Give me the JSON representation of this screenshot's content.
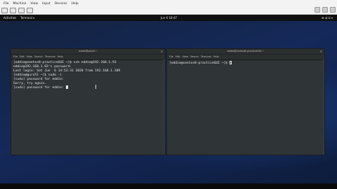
{
  "vbox": {
    "menu": [
      "File",
      "Machine",
      "View",
      "Input",
      "Devices",
      "Help"
    ]
  },
  "topbar": {
    "activities": "Activities",
    "app": "Terminal ▾",
    "clock": "Jun 6 18:47",
    "system": "⊞ ◂) ⏻ ▾"
  },
  "term_left": {
    "title": "eddie@solo0:~",
    "close": "✕",
    "menu": [
      "File",
      "Edit",
      "View",
      "Search",
      "Terminal",
      "Help"
    ],
    "lines": [
      "[eddie@centos8-practiceGUI ~]$ ssh eddie@192.168.1.93",
      "eddie@192.168.1.93's password:",
      "Last login: Sat Jun  6 14:53:31 2020 from 192.168.1.109",
      "[eddie@guru51 ~]$ sudo -i",
      "[sudo] password for eddie:",
      "Sorry, try again.",
      "[sudo] password for eddie: "
    ]
  },
  "term_right": {
    "title": "eddie@centos8-practiceGUI:~",
    "close": "✕",
    "menu": [
      "File",
      "Edit",
      "View",
      "Search",
      "Terminal",
      "Help"
    ],
    "lines": [
      "[eddie@centos8-practiceGUI ~]$ "
    ]
  }
}
